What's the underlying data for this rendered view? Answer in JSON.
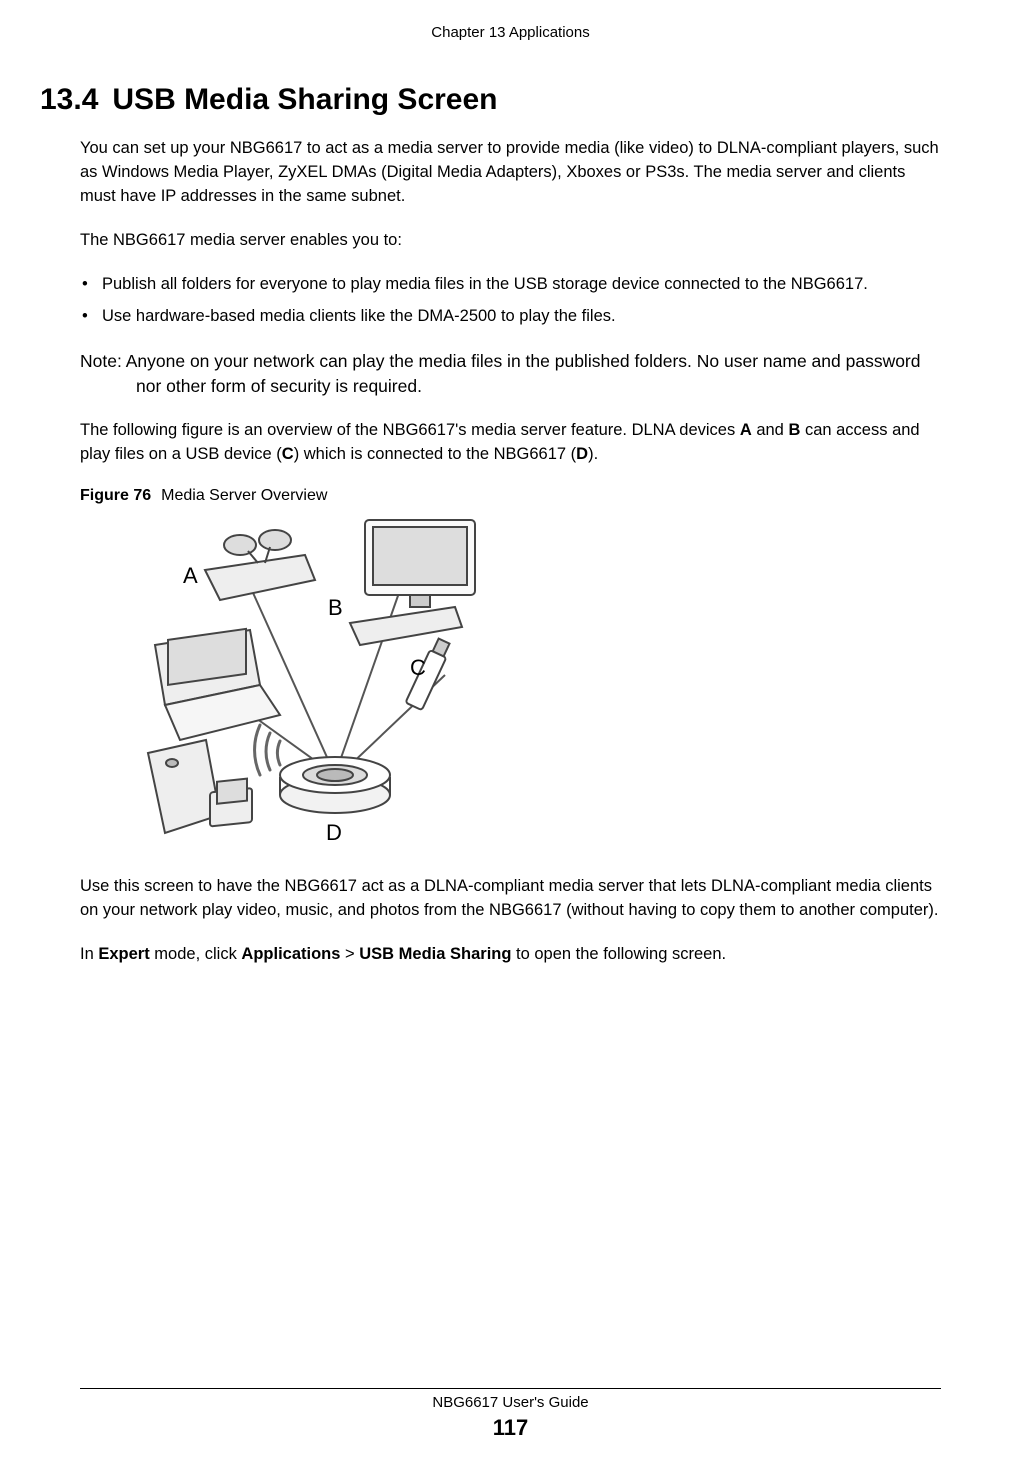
{
  "header": {
    "chapter": "Chapter 13 Applications"
  },
  "section": {
    "number": "13.4",
    "title": "USB Media Sharing Screen"
  },
  "paragraphs": {
    "intro": "You can set up your NBG6617 to act as a media server to provide media (like video) to DLNA-compliant players, such as Windows Media Player, ZyXEL DMAs (Digital Media Adapters), Xboxes or PS3s. The media server and clients must have IP addresses in the same subnet.",
    "enables_lead": "The NBG6617 media server enables you to:",
    "bullet1": "Publish all folders for everyone to play media files in the USB storage device connected to the NBG6617.",
    "bullet2": "Use hardware-based media clients like the DMA-2500 to play the files.",
    "note_label": "Note: ",
    "note_body": "Anyone on your network can play the media files in the published folders. No user name and password nor other form of security is required.",
    "overview_a": "The following figure is an overview of the NBG6617's media server feature. DLNA devices ",
    "overview_b": " and ",
    "overview_c": " can access and play files on a USB device (",
    "overview_d": ") which is connected to the NBG6617 (",
    "overview_e": ").",
    "bold_A": "A",
    "bold_B": "B",
    "bold_C": "C",
    "bold_D": "D",
    "use_screen": "Use this screen to have the NBG6617 act as a DLNA-compliant media server that lets DLNA-compliant media clients on your network play video, music, and photos from the NBG6617 (without having to copy them to another computer).",
    "nav_a": "In ",
    "nav_expert": "Expert",
    "nav_b": " mode, click ",
    "nav_apps": "Applications",
    "nav_c": " > ",
    "nav_usb": "USB Media Sharing",
    "nav_d": " to open the following screen."
  },
  "figure": {
    "number": "Figure 76",
    "caption": "Media Server Overview",
    "labels": {
      "A": "A",
      "B": "B",
      "C": "C",
      "D": "D"
    }
  },
  "footer": {
    "guide": "NBG6617 User's Guide",
    "page": "117"
  }
}
